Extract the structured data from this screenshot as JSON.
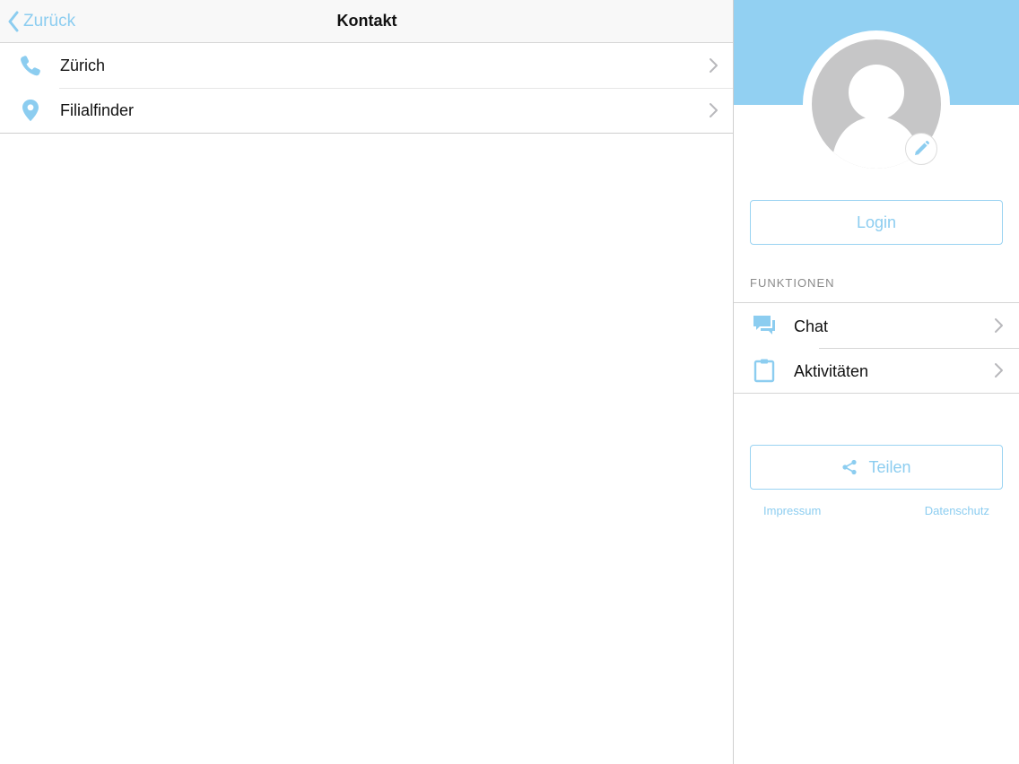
{
  "navbar": {
    "back_label": "Zurück",
    "title": "Kontakt"
  },
  "contact_list": [
    {
      "label": "Zürich",
      "icon": "phone-icon"
    },
    {
      "label": "Filialfinder",
      "icon": "location-pin-icon"
    }
  ],
  "side": {
    "login_label": "Login",
    "section_title": "FUNKTIONEN",
    "functions": [
      {
        "label": "Chat",
        "icon": "chat-bubbles-icon"
      },
      {
        "label": "Aktivitäten",
        "icon": "clipboard-icon"
      }
    ],
    "share_label": "Teilen",
    "footer": {
      "impressum": "Impressum",
      "datenschutz": "Datenschutz"
    }
  },
  "colors": {
    "accent": "#8ccdf0",
    "header_blue": "#92d0f2",
    "avatar_gray": "#c6c6c7",
    "chevron": "#b8b8bc"
  }
}
